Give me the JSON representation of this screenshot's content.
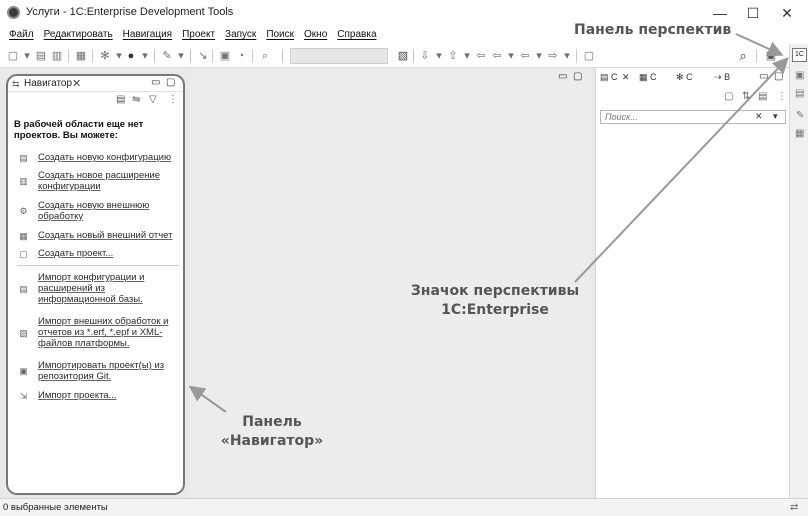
{
  "window": {
    "title": "Услуги - 1C:Enterprise Development Tools",
    "minimize": "—",
    "maximize": "☐",
    "close": "✕"
  },
  "menu": [
    "Файл",
    "Редактировать",
    "Навигация",
    "Проект",
    "Запуск",
    "Поиск",
    "Окно",
    "Справка"
  ],
  "navigator": {
    "tab_label": "Навигатор",
    "tab_close": "✕",
    "empty_message": "В рабочей области еще нет проектов. Вы можете:",
    "actions": [
      {
        "label": "Создать новую конфигурацию",
        "icon": "configuration-icon"
      },
      {
        "label": "Создать новое расширение конфигурации",
        "icon": "extension-icon"
      },
      {
        "label": "Создать новую внешнюю обработку",
        "icon": "external-processing-icon"
      },
      {
        "label": "Создать новый внешний отчет",
        "icon": "external-report-icon"
      },
      {
        "label": "Создать проект...",
        "icon": "project-icon"
      },
      {
        "label": "Импорт конфигурации и расширений из информационной базы.",
        "icon": "database-import-icon"
      },
      {
        "label": "Импорт внешних обработок и отчетов из *.erf, *.epf и XML-файлов платформы.",
        "icon": "files-import-icon"
      },
      {
        "label": "Импортировать проект(ы) из репозитория Git.",
        "icon": "git-import-icon"
      },
      {
        "label": "Импорт проекта...",
        "icon": "project-import-icon"
      }
    ]
  },
  "right_panel": {
    "tabs": [
      "С",
      "С",
      "С",
      "В"
    ],
    "tab_close": "✕",
    "search_placeholder": "Поиск..."
  },
  "perspective": {
    "icon_text": "1С"
  },
  "status": {
    "text": "0 выбранные элементы"
  },
  "annotations": {
    "perspective_panel": "Панель перспектив",
    "perspective_icon": "Значок перспективы 1C:Enterprise",
    "navigator_panel": "Панель «Навигатор»"
  }
}
